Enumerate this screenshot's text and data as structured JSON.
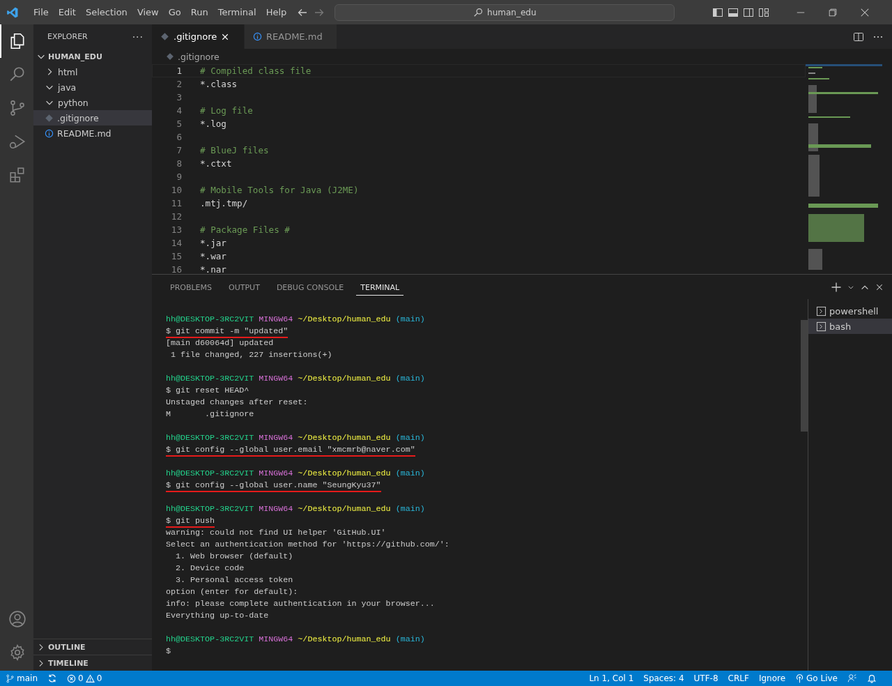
{
  "menu": [
    "File",
    "Edit",
    "Selection",
    "View",
    "Go",
    "Run",
    "Terminal",
    "Help"
  ],
  "command_center": {
    "value": "human_edu"
  },
  "explorer": {
    "title": "EXPLORER",
    "more": "···",
    "root": {
      "label": "HUMAN_EDU",
      "expanded": true
    },
    "items": [
      {
        "label": "html",
        "kind": "folder",
        "expanded": false,
        "selected": false
      },
      {
        "label": "java",
        "kind": "folder",
        "expanded": true,
        "selected": false
      },
      {
        "label": "python",
        "kind": "folder",
        "expanded": true,
        "selected": false
      },
      {
        "label": ".gitignore",
        "kind": "config",
        "selected": true
      },
      {
        "label": "README.md",
        "kind": "info",
        "selected": false
      }
    ],
    "sections": [
      {
        "label": "OUTLINE",
        "expanded": false
      },
      {
        "label": "TIMELINE",
        "expanded": false
      }
    ]
  },
  "tabs": [
    {
      "label": ".gitignore",
      "kind": "config",
      "selected": true
    },
    {
      "label": "README.md",
      "kind": "info",
      "selected": false
    }
  ],
  "breadcrumb": ".gitignore",
  "code": [
    {
      "number": "1",
      "text": "# Compiled class file",
      "kind": "comment",
      "current": true
    },
    {
      "number": "2",
      "text": "*.class",
      "kind": "pattern",
      "current": false
    },
    {
      "number": "3",
      "kind": "blank",
      "current": false
    },
    {
      "number": "4",
      "text": "# Log file",
      "kind": "comment",
      "current": false
    },
    {
      "number": "5",
      "text": "*.log",
      "kind": "pattern",
      "current": false
    },
    {
      "number": "6",
      "kind": "blank",
      "current": false
    },
    {
      "number": "7",
      "text": "# BlueJ files",
      "kind": "comment",
      "current": false
    },
    {
      "number": "8",
      "text": "*.ctxt",
      "kind": "pattern",
      "current": false
    },
    {
      "number": "9",
      "kind": "blank",
      "current": false
    },
    {
      "number": "10",
      "text": "# Mobile Tools for Java (J2ME)",
      "kind": "comment",
      "current": false
    },
    {
      "number": "11",
      "text": ".mtj.tmp/",
      "kind": "pattern",
      "current": false
    },
    {
      "number": "12",
      "kind": "blank",
      "current": false
    },
    {
      "number": "13",
      "text": "# Package Files #",
      "kind": "comment",
      "current": false
    },
    {
      "number": "14",
      "text": "*.jar",
      "kind": "pattern",
      "current": false
    },
    {
      "number": "15",
      "text": "*.war",
      "kind": "pattern",
      "current": false
    },
    {
      "number": "16",
      "text": "*.nar",
      "kind": "pattern",
      "current": false
    }
  ],
  "panel_tabs": [
    {
      "label": "PROBLEMS",
      "selected": false
    },
    {
      "label": "OUTPUT",
      "selected": false
    },
    {
      "label": "DEBUG CONSOLE",
      "selected": false
    },
    {
      "label": "TERMINAL",
      "selected": true
    }
  ],
  "terminal": [
    {
      "kind": "prompt",
      "user": "hh@DESKTOP-3RC2VIT",
      "system": "MINGW64",
      "path": "~/Desktop/human_edu",
      "branch": "(main)"
    },
    {
      "kind": "command",
      "text": "$ git commit -m \"updated\"",
      "underlined": true
    },
    {
      "kind": "output",
      "text": "[main d60064d] updated"
    },
    {
      "kind": "output",
      "text": " 1 file changed, 227 insertions(+)"
    },
    {
      "kind": "blank"
    },
    {
      "kind": "prompt",
      "user": "hh@DESKTOP-3RC2VIT",
      "system": "MINGW64",
      "path": "~/Desktop/human_edu",
      "branch": "(main)"
    },
    {
      "kind": "command",
      "text": "$ git reset HEAD^",
      "underlined": false
    },
    {
      "kind": "output",
      "text": "Unstaged changes after reset:"
    },
    {
      "kind": "output",
      "text": "M       .gitignore"
    },
    {
      "kind": "blank"
    },
    {
      "kind": "prompt",
      "user": "hh@DESKTOP-3RC2VIT",
      "system": "MINGW64",
      "path": "~/Desktop/human_edu",
      "branch": "(main)"
    },
    {
      "kind": "command",
      "text": "$ git config --global user.email \"xmcmrb@naver.com\"",
      "underlined": true
    },
    {
      "kind": "blank"
    },
    {
      "kind": "prompt",
      "user": "hh@DESKTOP-3RC2VIT",
      "system": "MINGW64",
      "path": "~/Desktop/human_edu",
      "branch": "(main)"
    },
    {
      "kind": "command",
      "text": "$ git config --global user.name \"SeungKyu37\"",
      "underlined": true
    },
    {
      "kind": "blank"
    },
    {
      "kind": "prompt",
      "user": "hh@DESKTOP-3RC2VIT",
      "system": "MINGW64",
      "path": "~/Desktop/human_edu",
      "branch": "(main)"
    },
    {
      "kind": "command",
      "text": "$ git push",
      "underlined": true
    },
    {
      "kind": "output",
      "text": "warning: could not find UI helper 'GitHub.UI'"
    },
    {
      "kind": "output",
      "text": "Select an authentication method for 'https://github.com/':"
    },
    {
      "kind": "output",
      "text": "  1. Web browser (default)"
    },
    {
      "kind": "output",
      "text": "  2. Device code"
    },
    {
      "kind": "output",
      "text": "  3. Personal access token"
    },
    {
      "kind": "output",
      "text": "option (enter for default):"
    },
    {
      "kind": "output",
      "text": "info: please complete authentication in your browser..."
    },
    {
      "kind": "output",
      "text": "Everything up-to-date"
    },
    {
      "kind": "blank"
    },
    {
      "kind": "prompt",
      "user": "hh@DESKTOP-3RC2VIT",
      "system": "MINGW64",
      "path": "~/Desktop/human_edu",
      "branch": "(main)"
    },
    {
      "kind": "command",
      "text": "$",
      "underlined": false
    }
  ],
  "terminals": [
    {
      "label": "powershell",
      "selected": false
    },
    {
      "label": "bash",
      "selected": true
    }
  ],
  "status_bar": {
    "branch": "main",
    "errors": "0",
    "warnings": "0",
    "right": [
      "Ln 1, Col 1",
      "Spaces: 4",
      "UTF-8",
      "CRLF",
      "Ignore",
      "Go Live"
    ]
  }
}
